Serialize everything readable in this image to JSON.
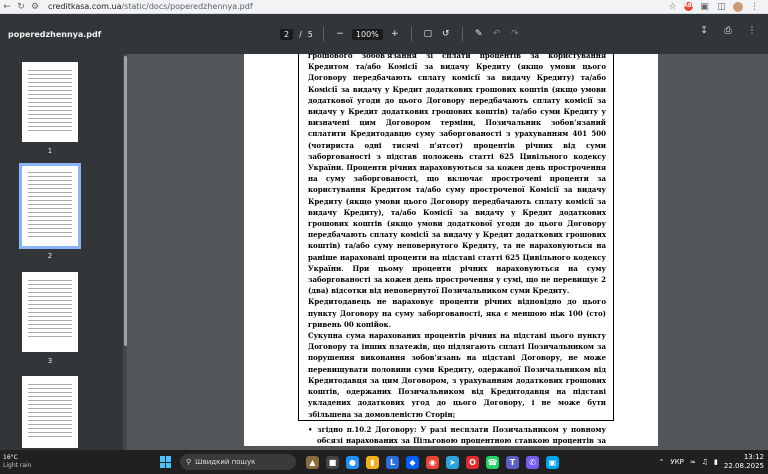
{
  "browser": {
    "url_host": "creditkasa.com.ua",
    "url_path": "/static/docs/poperedzhennya.pdf",
    "ext_badge": "ABP"
  },
  "pdf": {
    "title": "poperedzhennya.pdf",
    "page_current": "2",
    "page_total": "5",
    "page_sep": "/",
    "zoom": "100%"
  },
  "thumbnails": [
    {
      "num": "1"
    },
    {
      "num": "2",
      "selected": true
    },
    {
      "num": "3"
    },
    {
      "num": ""
    }
  ],
  "document": {
    "paragraphs": [
      "грошового зобов'язання зі сплати процентів за користування Кредитом та/або Комісії за видачу Кредиту (якщо умови цього Договору передбачають сплату комісії за видачу Кредиту) та/або Комісії за видачу у Кредит додаткових грошових коштів (якщо умови додаткової угоди до цього Договору передбачають сплату комісії за видачу у Кредит додаткових грошових коштів) та/або суми Кредиту у визначені цим Договором терміни, Позичальник зобов'язаний сплатити Кредитодавцю суму заборгованості з урахуванням 401 500 (чотириста одні тисячі п'ятсот) процентів річних від суми заборгованості з підстав положень статті 625 Цивільного кодексу України. Проценти річних нараховуються за кожен день прострочення на суму заборгованості, що включає прострочені проценти за користування Кредитом та/або суму простроченої Комісії за видачу Кредиту (якщо умови цього Договору передбачають сплату комісії за видачу Кредиту), та/або Комісії за видачу у Кредит додаткових грошових коштів (якщо умови додаткової угоди до цього Договору передбачають сплату комісії за видачу у Кредит додаткових грошових коштів) та/або суму неповернутого Кредиту, та не нараховуються на раніше нараховані проценти на підставі статті 625 Цивільного кодексу України. При цьому проценти річних нараховуються на суму заборгованості за кожен день прострочення у сумі, що не перевищує 2 (два) відсотки від неповернутої Позичальником суми Кредиту.",
      "Кредитодавець не нараховує проценти річних відповідно до цього пункту Договору на суму заборгованості, яка є меншою ніж 100 (сто) гривень 00 копійок.",
      "Сукупна сума нарахованих процентів річних на підставі цього пункту Договору та інших платежів, що підлягають сплаті Позичальником за порушення виконання зобов'язань на підставі Договору, не може перевищувати половини суми Кредиту, одержаної Позичальником від Кредитодавця за цим Договором, з урахуванням додаткових грошових коштів, одержаних Позичальником від Кредитодавця на підставі укладених додаткових угод до цього Договору, і не може бути збільшена за домовленістю Сторін;"
    ],
    "bullet": "згідно п.10.2 Договору: У разі несплати Позичальником у повному обсязі нарахованих за Пільговою процентною ставкою процентів за користування"
  },
  "taskbar": {
    "temp": "16°C",
    "weather": "Light rain",
    "search_placeholder": "Швидкий пошук",
    "lang": "УКР",
    "time": "13:12",
    "date": "22.08.2025"
  },
  "colors": {
    "toolbar": "#323639",
    "viewer_bg": "#525659",
    "thumb_highlight": "#8ab4f8"
  }
}
